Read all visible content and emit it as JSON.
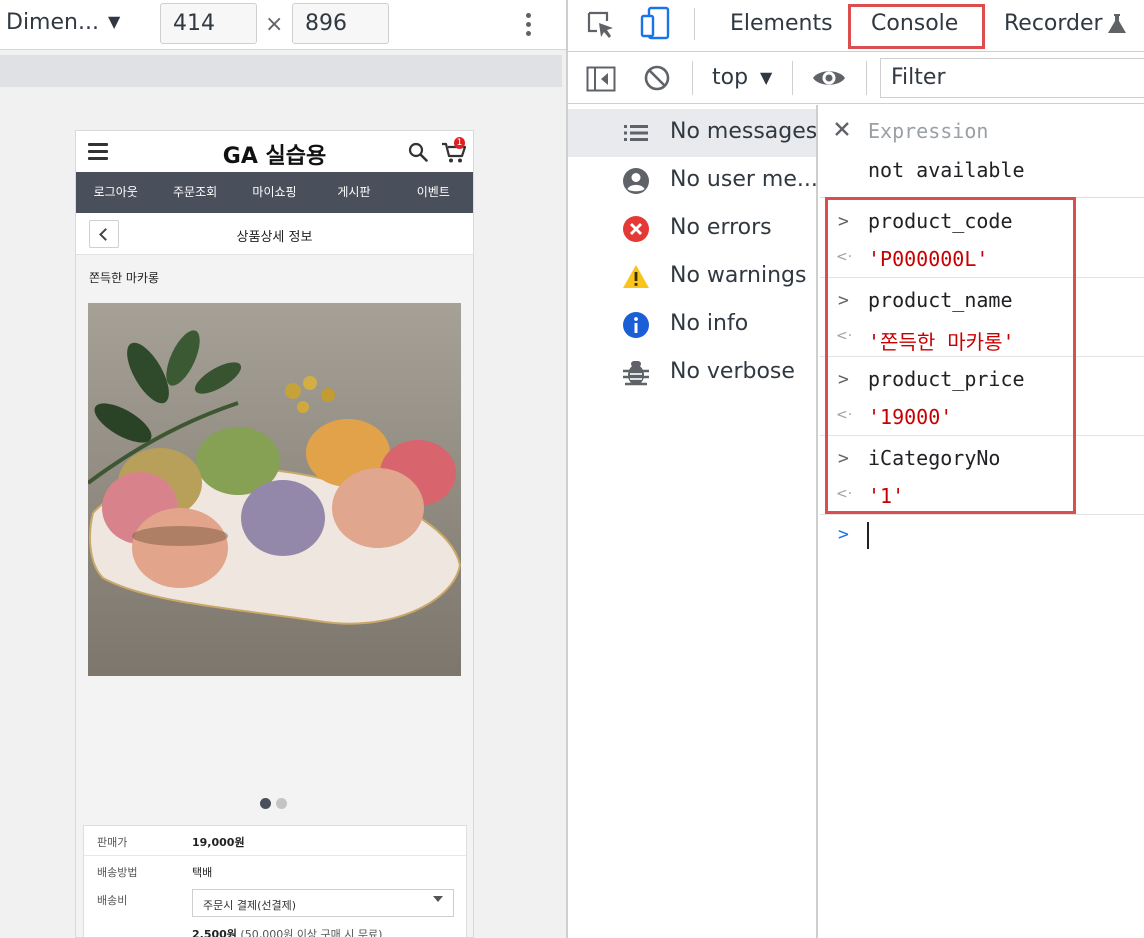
{
  "device_toolbar": {
    "dimensions_label": "Dimen...",
    "width": "414",
    "height": "896",
    "times": "×"
  },
  "mobile": {
    "site_title": "GA 실습용",
    "cart_count": "1",
    "nav": [
      "로그아웃",
      "주문조회",
      "마이쇼핑",
      "게시판",
      "이벤트"
    ],
    "page_title": "상품상세 정보",
    "product_name": "쫀득한 마카롱",
    "image_slides": {
      "active": 1,
      "total": 2
    },
    "info": {
      "price_label": "판매가",
      "price_value": "19,000원",
      "shipping_method_label": "배송방법",
      "shipping_method_value": "택배",
      "shipping_fee_label": "배송비",
      "shipping_fee_select": "주문시 결제(선결제)",
      "shipping_fee_amount": "2,500원",
      "shipping_fee_note": " (50,000원 이상 구매 시 무료)"
    },
    "colors": {
      "nav_bg": "#4a4f5c",
      "dot_active": "#4a4f5c",
      "dot_inactive": "#c4c4c4"
    }
  },
  "devtools": {
    "tabs": [
      "Elements",
      "Console",
      "Recorder"
    ],
    "active_tab": "Console",
    "console_toolbar": {
      "context": "top",
      "filter_placeholder": "Filter"
    },
    "sidebar": [
      {
        "label": "No messages",
        "icon": "list-icon"
      },
      {
        "label": "No user me...",
        "icon": "user-icon"
      },
      {
        "label": "No errors",
        "icon": "error-icon"
      },
      {
        "label": "No warnings",
        "icon": "warning-icon"
      },
      {
        "label": "No info",
        "icon": "info-icon"
      },
      {
        "label": "No verbose",
        "icon": "bug-icon"
      }
    ],
    "expression": {
      "label": "Expression",
      "value": "not available"
    },
    "entries": [
      {
        "input": "product_code",
        "output": "'P000000L'"
      },
      {
        "input": "product_name",
        "output": "'쫀득한 마카롱'"
      },
      {
        "input": "product_price",
        "output": "'19000'"
      },
      {
        "input": "iCategoryNo",
        "output": "'1'"
      }
    ],
    "colors": {
      "highlight": "#dc4d4d",
      "string_output": "#c80000",
      "prompt": "#1a73e8"
    }
  }
}
